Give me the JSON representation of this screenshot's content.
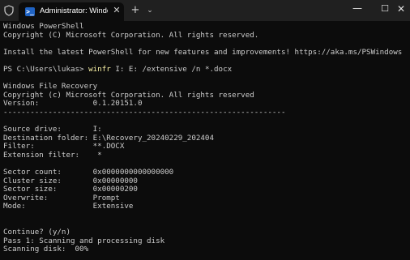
{
  "titlebar": {
    "shield_icon": "shield-icon",
    "tab_title": "Administrator: Windows PowerShell",
    "tab_icon_label": ">_",
    "tab_close": "✕",
    "new_tab": "+",
    "dropdown": "⌄",
    "minimize": "—",
    "maximize": "☐",
    "close": "✕"
  },
  "console": {
    "header": [
      "Windows PowerShell",
      "Copyright (C) Microsoft Corporation. All rights reserved.",
      "",
      "Install the latest PowerShell for new features and improvements! https://aka.ms/PSWindows",
      ""
    ],
    "prompt": "PS C:\\Users\\lukas> ",
    "command": "winfr",
    "command_args": " I: E: /extensive /n *.docx",
    "output": [
      "",
      "Windows File Recovery",
      "Copyright (c) Microsoft Corporation. All rights reserved",
      "Version:            0.1.20151.0",
      "---------------------------------------------------------------",
      "",
      "Source drive:       I:",
      "Destination folder: E:\\Recovery_20240229_202404",
      "Filter:             **.DOCX",
      "Extension filter:    *",
      "",
      "Sector count:       0x0000000000000000",
      "Cluster size:       0x00000000",
      "Sector size:        0x00000200",
      "Overwrite:          Prompt",
      "Mode:               Extensive",
      "",
      "",
      "Continue? (y/n)",
      "Pass 1: Scanning and processing disk",
      "Scanning disk:  00%"
    ]
  },
  "colors": {
    "background": "#0c0c0c",
    "titlebar": "#202020",
    "text": "#cccccc",
    "command": "#f9f1a5"
  }
}
